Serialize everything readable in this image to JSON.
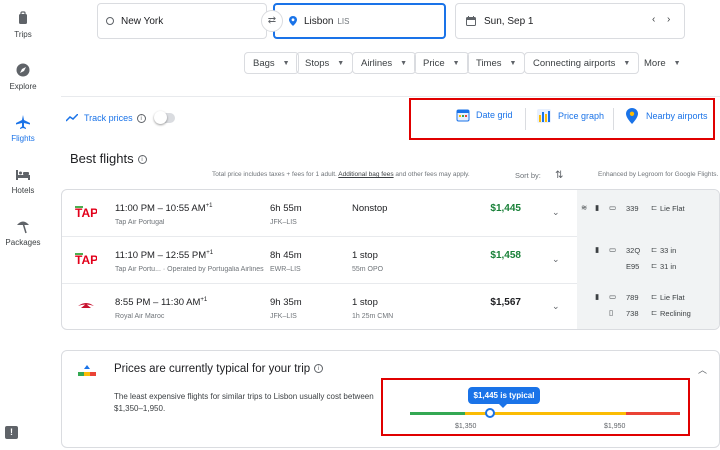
{
  "nav": [
    {
      "label": "Trips",
      "icon": "trips-icon"
    },
    {
      "label": "Explore",
      "icon": "explore-icon"
    },
    {
      "label": "Flights",
      "icon": "flights-icon"
    },
    {
      "label": "Hotels",
      "icon": "hotels-icon"
    },
    {
      "label": "Packages",
      "icon": "packages-icon"
    }
  ],
  "search": {
    "origin": "New York",
    "destination": "Lisbon",
    "destination_code": "LIS",
    "date": "Sun, Sep 1"
  },
  "filters": [
    "Bags",
    "Stops",
    "Airlines",
    "Price",
    "Times",
    "Connecting airports",
    "More"
  ],
  "track_prices": "Track prices",
  "tools": {
    "date_grid": "Date grid",
    "price_graph": "Price graph",
    "nearby_airports": "Nearby airports"
  },
  "best_flights": "Best flights",
  "meta": {
    "price_note_prefix": "Total price includes taxes + fees for 1 adult.",
    "bag_fees": "Additional bag fees",
    "price_note_suffix": "and other fees may apply.",
    "sort_by": "Sort by:",
    "legroom": "Enhanced by Legroom for Google Flights."
  },
  "flights": [
    {
      "time": "11:00 PM – 10:55 AM",
      "plus": "+1",
      "airline": "Tap Air Portugal",
      "duration": "6h 55m",
      "route": "JFK–LIS",
      "stops": "Nonstop",
      "layover": "",
      "price": "$1,445",
      "amenities": {
        "a1": "339",
        "a2": "Lie Flat",
        "b1": "",
        "b2": ""
      }
    },
    {
      "time": "11:10 PM – 12:55 PM",
      "plus": "+1",
      "airline": "Tap Air Portu... · Operated by Portugalia Airlines",
      "duration": "8h 45m",
      "route": "EWR–LIS",
      "stops": "1 stop",
      "layover": "55m OPO",
      "price": "$1,458",
      "amenities": {
        "a1": "32Q",
        "a2": "33 in",
        "b1": "E95",
        "b2": "31 in"
      }
    },
    {
      "time": "8:55 PM – 11:30 AM",
      "plus": "+1",
      "airline": "Royal Air Maroc",
      "duration": "9h 35m",
      "route": "JFK–LIS",
      "stops": "1 stop",
      "layover": "1h 25m CMN",
      "price": "$1,567",
      "amenities": {
        "a1": "789",
        "a2": "Lie Flat",
        "b1": "738",
        "b2": "Reclining"
      }
    }
  ],
  "price_insight": {
    "title": "Prices are currently typical for your trip",
    "description": "The least expensive flights for similar trips to Lisbon usually cost between $1,350–1,950.",
    "bubble": "$1,445 is typical",
    "low": "$1,350",
    "high": "$1,950",
    "current_price": 1445,
    "typical_low": 1350,
    "typical_high": 1950
  },
  "colors": {
    "accent": "#1a73e8",
    "green": "#188038",
    "highlight": "#e00000",
    "bar_low": "#34a853",
    "bar_typical": "#fbbc04",
    "bar_high": "#ea4335"
  }
}
